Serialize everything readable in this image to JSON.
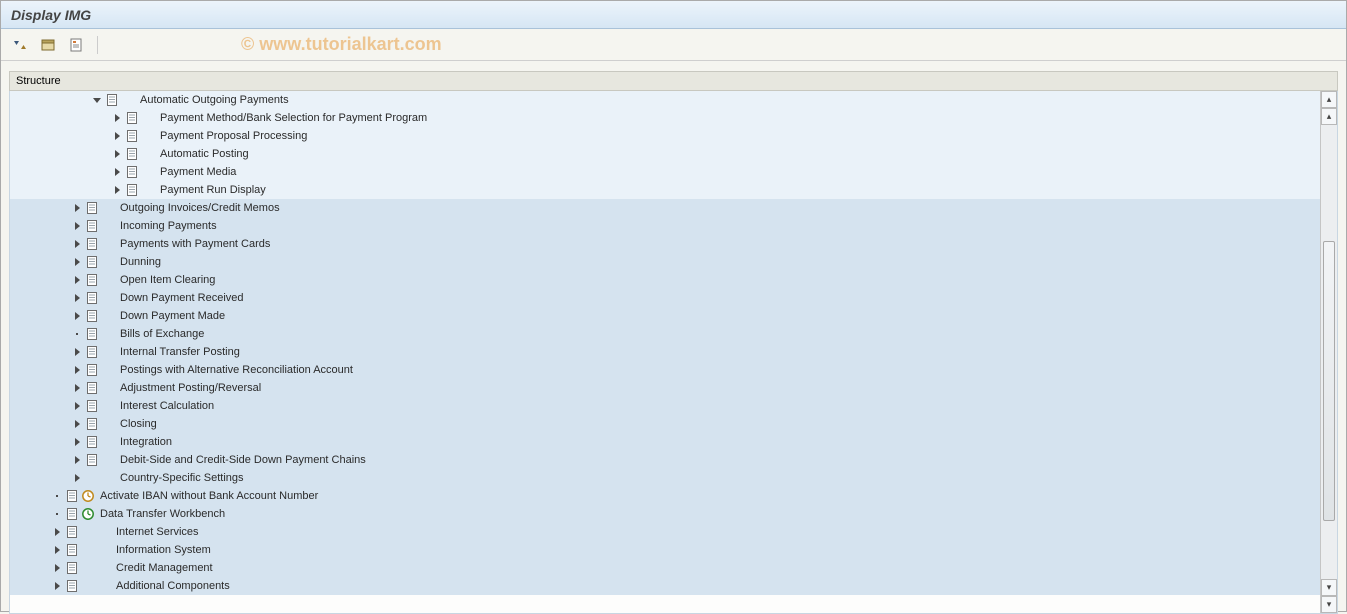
{
  "header": {
    "title": "Display IMG"
  },
  "watermark": "© www.tutorialkart.com",
  "column_header": "Structure",
  "tree": [
    {
      "indent": 80,
      "twisty": "open",
      "doc": true,
      "clock": null,
      "extra_gap": 16,
      "label": "Automatic Outgoing Payments",
      "shade": "light"
    },
    {
      "indent": 100,
      "twisty": "closed",
      "doc": true,
      "clock": null,
      "extra_gap": 16,
      "label": "Payment Method/Bank Selection for Payment Program",
      "shade": "light"
    },
    {
      "indent": 100,
      "twisty": "closed",
      "doc": true,
      "clock": null,
      "extra_gap": 16,
      "label": "Payment Proposal Processing",
      "shade": "light"
    },
    {
      "indent": 100,
      "twisty": "closed",
      "doc": true,
      "clock": null,
      "extra_gap": 16,
      "label": "Automatic Posting",
      "shade": "light"
    },
    {
      "indent": 100,
      "twisty": "closed",
      "doc": true,
      "clock": null,
      "extra_gap": 16,
      "label": "Payment Media",
      "shade": "light"
    },
    {
      "indent": 100,
      "twisty": "closed",
      "doc": true,
      "clock": null,
      "extra_gap": 16,
      "label": "Payment Run Display",
      "shade": "light"
    },
    {
      "indent": 60,
      "twisty": "closed",
      "doc": true,
      "clock": null,
      "extra_gap": 16,
      "label": "Outgoing Invoices/Credit Memos",
      "shade": "dark"
    },
    {
      "indent": 60,
      "twisty": "closed",
      "doc": true,
      "clock": null,
      "extra_gap": 16,
      "label": "Incoming Payments",
      "shade": "dark"
    },
    {
      "indent": 60,
      "twisty": "closed",
      "doc": true,
      "clock": null,
      "extra_gap": 16,
      "label": "Payments with Payment Cards",
      "shade": "dark"
    },
    {
      "indent": 60,
      "twisty": "closed",
      "doc": true,
      "clock": null,
      "extra_gap": 16,
      "label": "Dunning",
      "shade": "dark"
    },
    {
      "indent": 60,
      "twisty": "closed",
      "doc": true,
      "clock": null,
      "extra_gap": 16,
      "label": "Open Item Clearing",
      "shade": "dark"
    },
    {
      "indent": 60,
      "twisty": "closed",
      "doc": true,
      "clock": null,
      "extra_gap": 16,
      "label": "Down Payment Received",
      "shade": "dark"
    },
    {
      "indent": 60,
      "twisty": "closed",
      "doc": true,
      "clock": null,
      "extra_gap": 16,
      "label": "Down Payment Made",
      "shade": "dark"
    },
    {
      "indent": 60,
      "twisty": "leaf",
      "doc": true,
      "clock": null,
      "extra_gap": 16,
      "label": "Bills of Exchange",
      "shade": "dark"
    },
    {
      "indent": 60,
      "twisty": "closed",
      "doc": true,
      "clock": null,
      "extra_gap": 16,
      "label": "Internal Transfer Posting",
      "shade": "dark"
    },
    {
      "indent": 60,
      "twisty": "closed",
      "doc": true,
      "clock": null,
      "extra_gap": 16,
      "label": "Postings with Alternative Reconciliation Account",
      "shade": "dark"
    },
    {
      "indent": 60,
      "twisty": "closed",
      "doc": true,
      "clock": null,
      "extra_gap": 16,
      "label": "Adjustment Posting/Reversal",
      "shade": "dark"
    },
    {
      "indent": 60,
      "twisty": "closed",
      "doc": true,
      "clock": null,
      "extra_gap": 16,
      "label": "Interest Calculation",
      "shade": "dark"
    },
    {
      "indent": 60,
      "twisty": "closed",
      "doc": true,
      "clock": null,
      "extra_gap": 16,
      "label": "Closing",
      "shade": "dark"
    },
    {
      "indent": 60,
      "twisty": "closed",
      "doc": true,
      "clock": null,
      "extra_gap": 16,
      "label": "Integration",
      "shade": "dark"
    },
    {
      "indent": 60,
      "twisty": "closed",
      "doc": true,
      "clock": null,
      "extra_gap": 16,
      "label": "Debit-Side and Credit-Side Down Payment Chains",
      "shade": "dark"
    },
    {
      "indent": 60,
      "twisty": "closed",
      "doc": false,
      "clock": null,
      "extra_gap": 32,
      "label": "Country-Specific Settings",
      "shade": "dark"
    },
    {
      "indent": 40,
      "twisty": "leaf",
      "doc": true,
      "clock": "gold",
      "extra_gap": 0,
      "label": "Activate IBAN without Bank Account Number",
      "shade": "dark"
    },
    {
      "indent": 40,
      "twisty": "leaf",
      "doc": true,
      "clock": "green",
      "extra_gap": 0,
      "label": "Data Transfer Workbench",
      "shade": "dark"
    },
    {
      "indent": 40,
      "twisty": "closed",
      "doc": true,
      "clock": null,
      "extra_gap": 32,
      "label": "Internet Services",
      "shade": "dark"
    },
    {
      "indent": 40,
      "twisty": "closed",
      "doc": true,
      "clock": null,
      "extra_gap": 32,
      "label": "Information System",
      "shade": "dark"
    },
    {
      "indent": 40,
      "twisty": "closed",
      "doc": true,
      "clock": null,
      "extra_gap": 32,
      "label": "Credit Management",
      "shade": "dark"
    },
    {
      "indent": 40,
      "twisty": "closed",
      "doc": true,
      "clock": null,
      "extra_gap": 32,
      "label": "Additional Components",
      "shade": "dark"
    }
  ]
}
